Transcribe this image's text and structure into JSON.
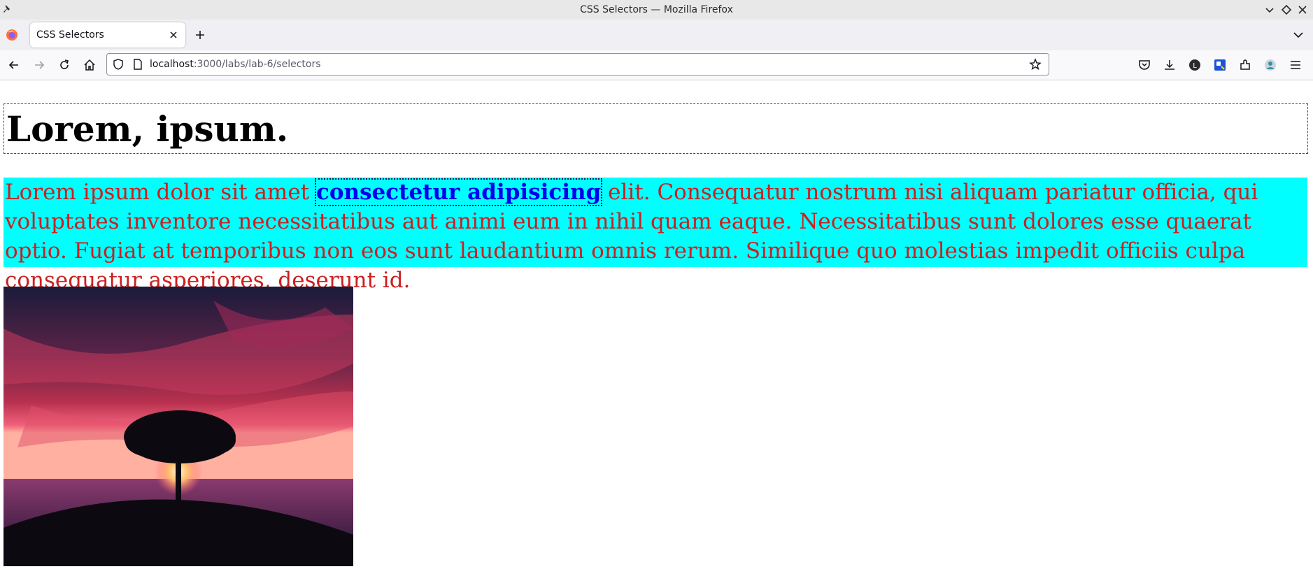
{
  "window": {
    "title": "CSS Selectors — Mozilla Firefox"
  },
  "tabs": [
    {
      "label": "CSS Selectors",
      "active": true
    }
  ],
  "address_bar": {
    "host": "localhost",
    "path": ":3000/labs/lab-6/selectors"
  },
  "toolbar": {
    "icons": [
      "back-arrow-icon",
      "forward-arrow-icon",
      "reload-icon",
      "home-icon",
      "pocket-icon",
      "download-icon",
      "account-icon",
      "extension-icon",
      "extensions-icon",
      "profile-icon",
      "menu-icon"
    ]
  },
  "page": {
    "heading": "Lorem, ipsum.",
    "paragraph": {
      "before": "Lorem ipsum dolor sit amet ",
      "emphasis": "consectetur adipisicing",
      "after": " elit. Consequatur nostrum nisi aliquam pariatur officia, qui voluptates inventore necessitatibus aut animi eum in nihil quam eaque. Necessitatibus sunt dolores esse quaerat optio. Fugiat at temporibus non eos sunt laudantium omnis rerum. Similique quo molestias impedit officiis culpa consequatur asperiores, deserunt id."
    },
    "image": {
      "subject": "tree-at-sunset"
    }
  },
  "colors": {
    "heading_border": "#e8000d",
    "paragraph_background": "#00ffff",
    "paragraph_text": "#cc2020",
    "emphasis_text": "#0000ee"
  }
}
